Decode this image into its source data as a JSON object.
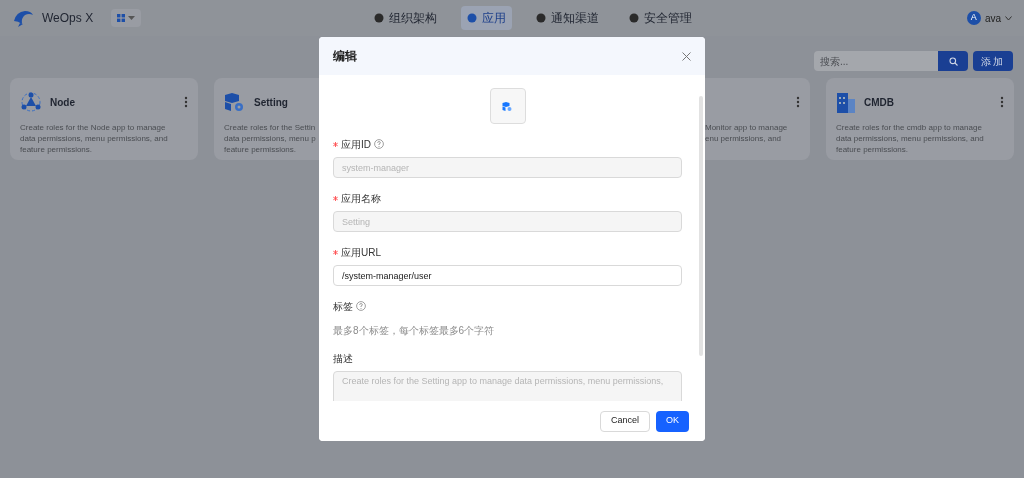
{
  "header": {
    "brand": "WeOps X",
    "nav": [
      {
        "label": "组织架构",
        "selected": false
      },
      {
        "label": "应用",
        "selected": true
      },
      {
        "label": "通知渠道",
        "selected": false
      },
      {
        "label": "安全管理",
        "selected": false
      }
    ],
    "user": {
      "initial": "A",
      "name": "ava"
    }
  },
  "toolbar": {
    "search_placeholder": "搜索...",
    "add_button": "添加"
  },
  "cards": [
    {
      "title": "Node",
      "lines": [
        "Create roles for the Node app to manage",
        "data permissions, menu permissions, and",
        "feature permissions."
      ]
    },
    {
      "title": "Setting",
      "lines": [
        "Create roles for the Settin",
        "data permissions, menu p",
        "feature permissions."
      ]
    },
    {
      "lines": [
        "Monitor app to manage",
        "enu permissions, and"
      ]
    },
    {
      "title": "CMDB",
      "lines": [
        "Create roles for the cmdb app to manage",
        "data permissions, menu permissions, and",
        "feature permissions."
      ]
    }
  ],
  "modal": {
    "title": "编辑",
    "fields": [
      {
        "kind": "input",
        "label": "应用ID",
        "required": true,
        "help": true,
        "value": "system-manager",
        "disabled": true
      },
      {
        "kind": "input",
        "label": "应用名称",
        "required": true,
        "help": false,
        "value": "Setting",
        "disabled": true
      },
      {
        "kind": "input",
        "label": "应用URL",
        "required": true,
        "help": false,
        "value": "/system-manager/user",
        "disabled": false
      },
      {
        "kind": "tags",
        "label": "标签",
        "required": false,
        "help": true,
        "hint": "最多8个标签，每个标签最多6个字符"
      },
      {
        "kind": "textarea",
        "label": "描述",
        "required": false,
        "help": false,
        "value": "Create roles for the Setting app to manage data permissions, menu permissions,",
        "disabled": true
      }
    ],
    "cancel": "Cancel",
    "ok": "OK"
  }
}
